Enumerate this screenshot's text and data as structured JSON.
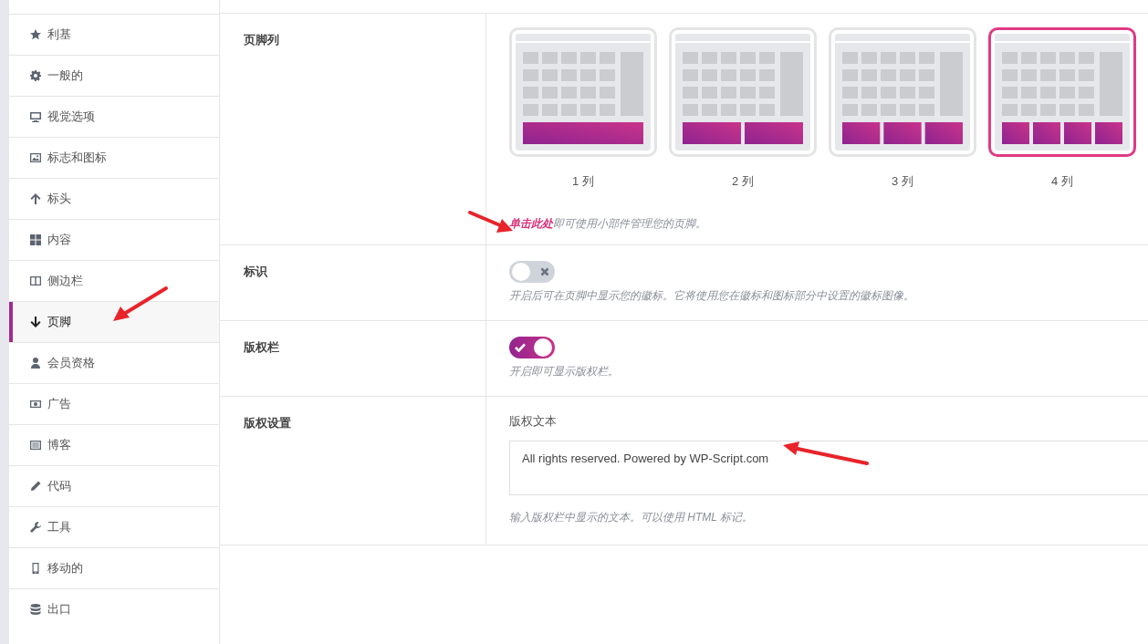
{
  "sidebar": {
    "items": [
      {
        "label": "利基",
        "selected": false
      },
      {
        "label": "一般的",
        "selected": false
      },
      {
        "label": "视觉选项",
        "selected": false
      },
      {
        "label": "标志和图标",
        "selected": false
      },
      {
        "label": "标头",
        "selected": false
      },
      {
        "label": "内容",
        "selected": false
      },
      {
        "label": "侧边栏",
        "selected": false
      },
      {
        "label": "页脚",
        "selected": true
      },
      {
        "label": "会员资格",
        "selected": false
      },
      {
        "label": "广告",
        "selected": false
      },
      {
        "label": "博客",
        "selected": false
      },
      {
        "label": "代码",
        "selected": false
      },
      {
        "label": "工具",
        "selected": false
      },
      {
        "label": "移动的",
        "selected": false
      },
      {
        "label": "出口",
        "selected": false
      }
    ]
  },
  "settings": [
    {
      "kind": "layout",
      "label": "页脚列",
      "options": [
        {
          "label": "1 列",
          "selected": false
        },
        {
          "label": "2 列",
          "selected": false
        },
        {
          "label": "3 列",
          "selected": false
        },
        {
          "label": "4 列",
          "selected": true
        }
      ],
      "help_link": "单击此处",
      "help": "即可使用小部件管理您的页脚。"
    },
    {
      "kind": "toggle",
      "label": "标识",
      "on": false,
      "help": "开启后可在页脚中显示您的徽标。它将使用您在徽标和图标部分中设置的徽标图像。"
    },
    {
      "kind": "toggle",
      "label": "版权栏",
      "on": true,
      "help": "开启即可显示版权栏。"
    },
    {
      "kind": "text",
      "label": "版权设置",
      "field_label": "版权文本",
      "value": "All rights reserved. Powered by WP-Script.com",
      "help": "输入版权栏中显示的文本。可以使用 HTML 标记。"
    }
  ]
}
